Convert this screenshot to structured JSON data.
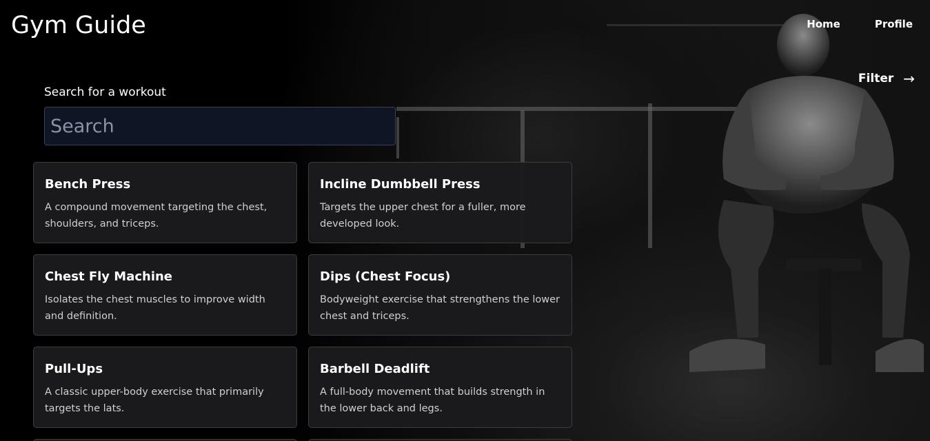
{
  "header": {
    "brand": "Gym Guide",
    "nav": [
      {
        "label": "Home"
      },
      {
        "label": "Profile"
      }
    ]
  },
  "filter": {
    "label": "Filter",
    "arrow": "→"
  },
  "search": {
    "label": "Search for a workout",
    "placeholder": "Search",
    "value": ""
  },
  "workouts": [
    {
      "title": "Bench Press",
      "description": "A compound movement targeting the chest, shoulders, and triceps."
    },
    {
      "title": "Incline Dumbbell Press",
      "description": "Targets the upper chest for a fuller, more developed look."
    },
    {
      "title": "Chest Fly Machine",
      "description": "Isolates the chest muscles to improve width and definition."
    },
    {
      "title": "Dips (Chest Focus)",
      "description": "Bodyweight exercise that strengthens the lower chest and triceps."
    },
    {
      "title": "Pull-Ups",
      "description": "A classic upper-body exercise that primarily targets the lats."
    },
    {
      "title": "Barbell Deadlift",
      "description": "A full-body movement that builds strength in the lower back and legs."
    }
  ],
  "icons": {
    "filter_arrow": "arrow-right-icon"
  },
  "colors": {
    "background": "#000000",
    "card_bg": "#1b1b1d",
    "card_border": "#3c3c42",
    "search_bg": "#0f1524"
  }
}
